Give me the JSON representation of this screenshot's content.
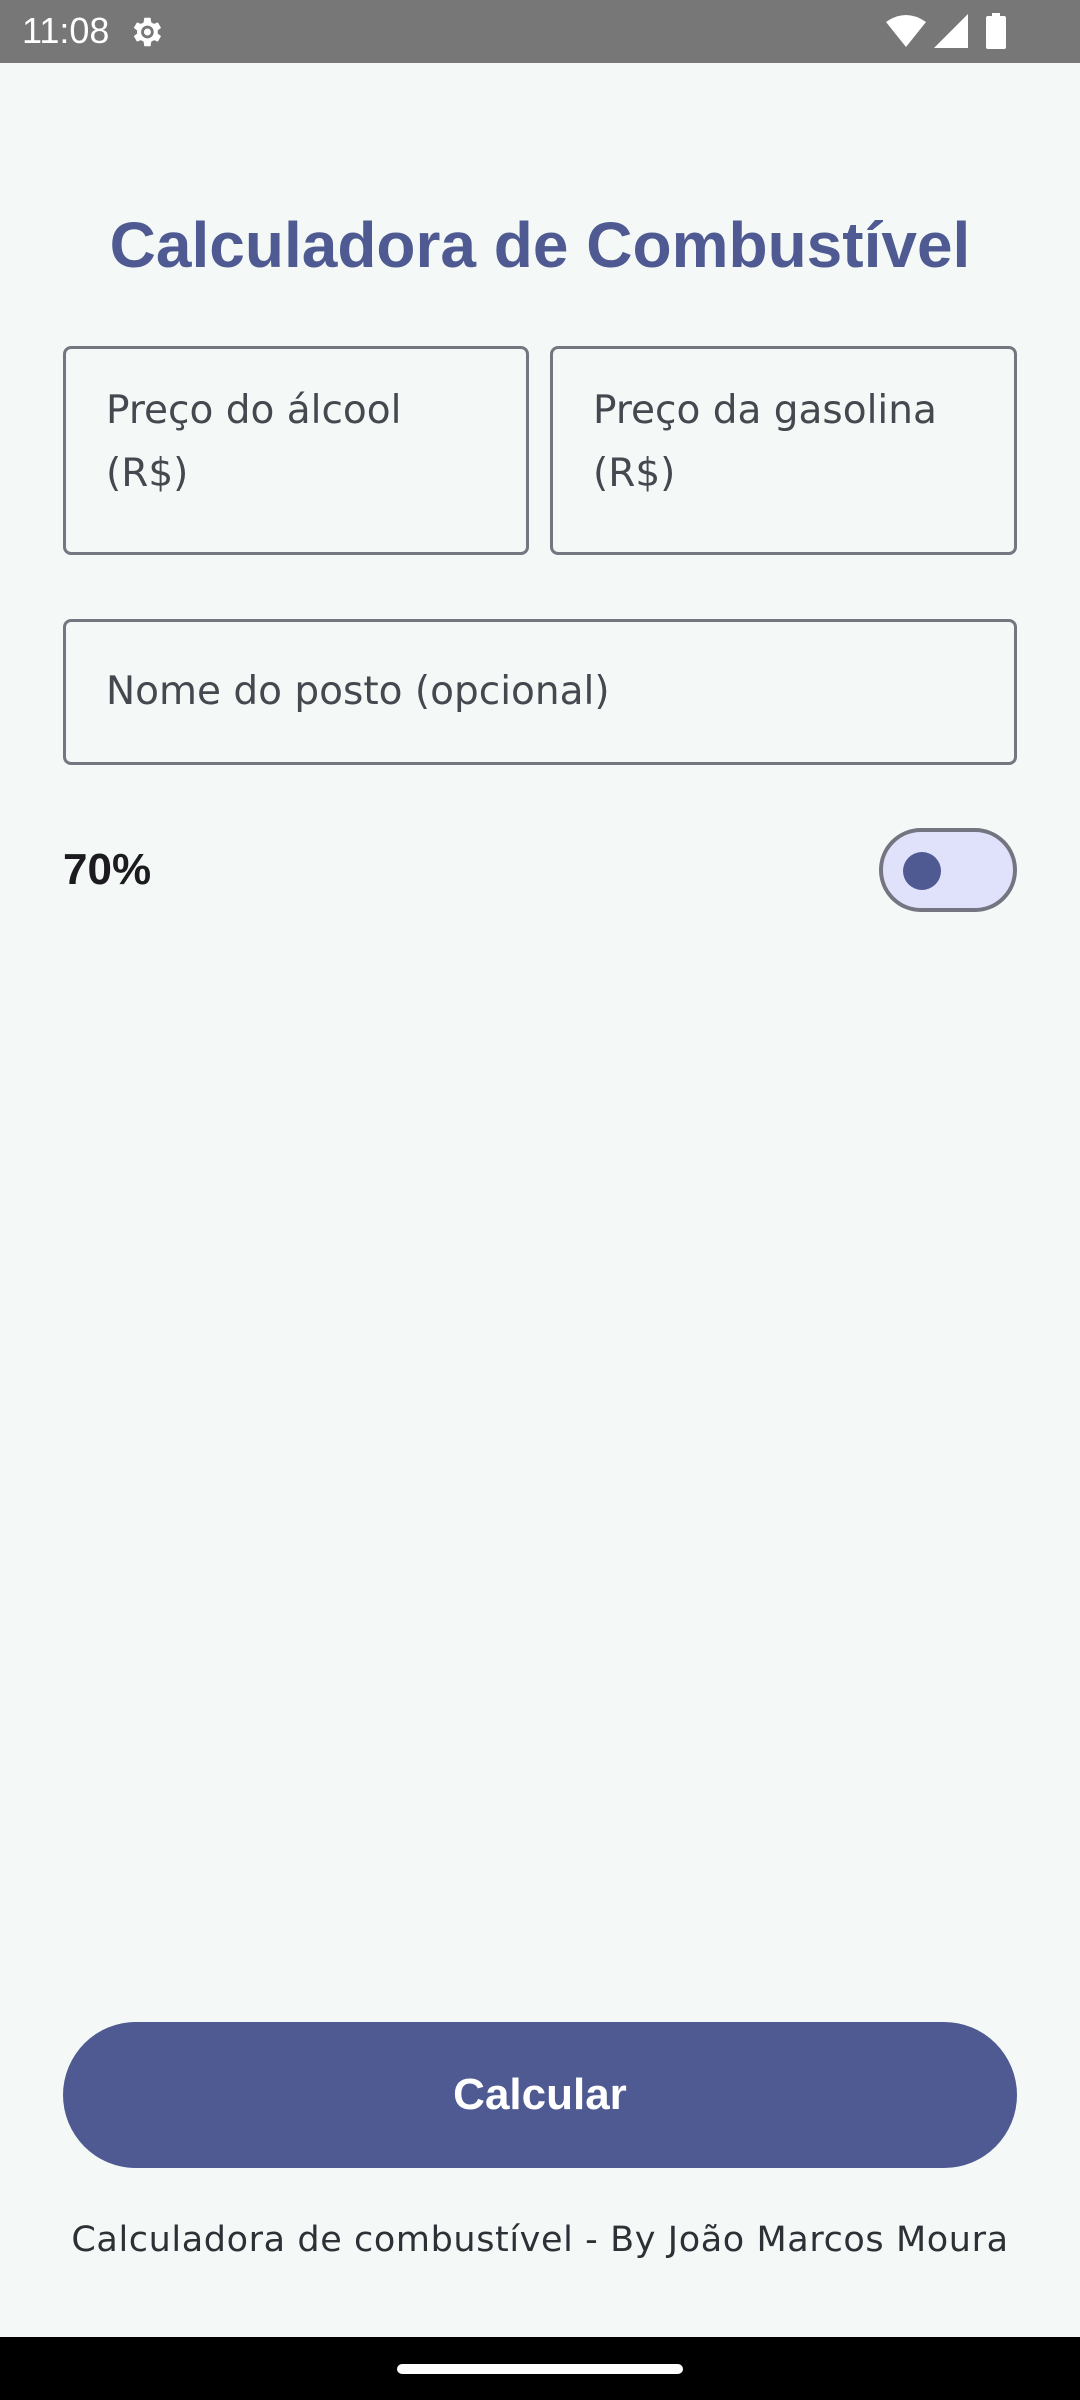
{
  "status_bar": {
    "time": "11:08",
    "icons": [
      "gear-icon",
      "wifi-icon",
      "signal-icon",
      "battery-icon"
    ]
  },
  "app": {
    "title": "Calculadora de Combustível"
  },
  "form": {
    "alcool_placeholder": "Preço do álcool (R$)",
    "alcool_value": "",
    "gasolina_placeholder": "Preço da gasolina (R$)",
    "gasolina_value": "",
    "posto_placeholder": "Nome do posto (opcional)",
    "posto_value": ""
  },
  "percentage": {
    "label": "70%",
    "toggle_on": false
  },
  "actions": {
    "calculate_label": "Calcular"
  },
  "footer": {
    "text": "Calculadora de combustível - By João Marcos Moura"
  },
  "colors": {
    "primary": "#4e5a91",
    "background": "#f4f9f7",
    "toggle_track": "#e0e1fb",
    "outline": "#737780",
    "status_bar": "#777777"
  }
}
